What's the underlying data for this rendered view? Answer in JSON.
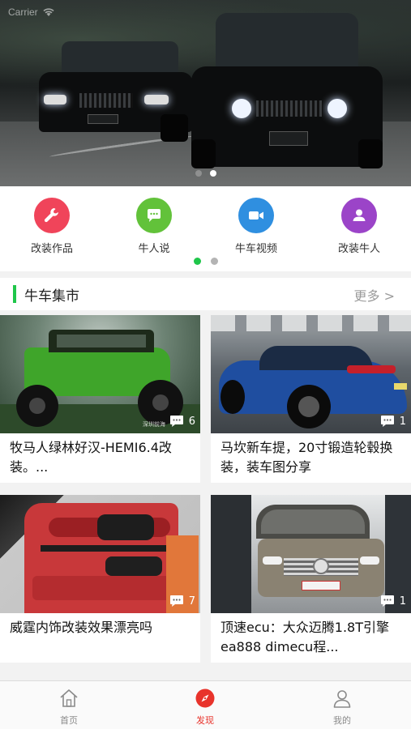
{
  "status_bar": {
    "carrier": "Carrier"
  },
  "banner": {
    "slide_count": 2,
    "active_slide": 2
  },
  "quick_menu": {
    "items": [
      {
        "label": "改装作品",
        "icon": "wrench-icon",
        "color": "#f0445a"
      },
      {
        "label": "牛人说",
        "icon": "chat-bubble-icon",
        "color": "#62c23a"
      },
      {
        "label": "牛车视频",
        "icon": "video-camera-icon",
        "color": "#2f8fe0"
      },
      {
        "label": "改装牛人",
        "icon": "person-icon",
        "color": "#9b44c8"
      }
    ],
    "page_count": 2,
    "active_page": 1
  },
  "market": {
    "title": "牛车集市",
    "more_label": "更多 >",
    "cards": [
      {
        "title": "牧马人绿林好汉-HEMI6.4改装。...",
        "comments": "6",
        "watermark": "深圳前海"
      },
      {
        "title": "马坎新车提，20寸锻造轮毂换装，装车图分享",
        "comments": "1"
      },
      {
        "title": "威霆内饰改装效果漂亮吗",
        "comments": "7"
      },
      {
        "title": "顶速ecu：大众迈腾1.8T引擎 ea888 dimecu程...",
        "comments": "1"
      }
    ]
  },
  "tab_bar": {
    "tabs": [
      {
        "label": "首页",
        "icon": "home-icon"
      },
      {
        "label": "发现",
        "icon": "compass-icon",
        "active": true
      },
      {
        "label": "我的",
        "icon": "profile-icon"
      }
    ],
    "active_color": "#e8332b"
  },
  "accent_color": "#1fc64a"
}
